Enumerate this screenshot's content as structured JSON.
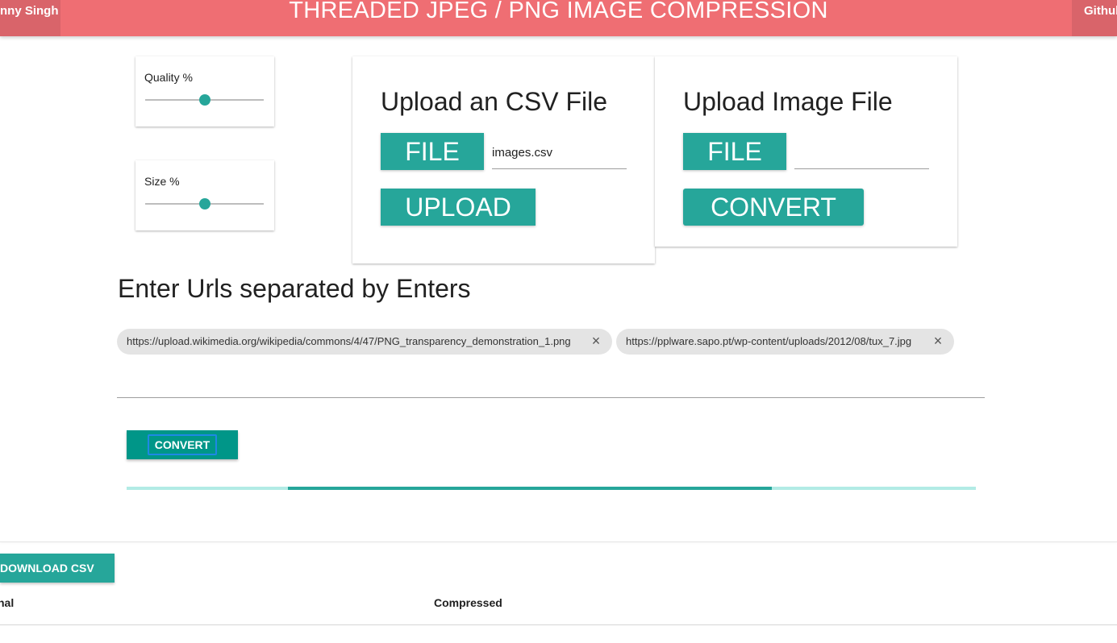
{
  "header": {
    "left_link": "nny Singh",
    "title": "THREADED JPEG / PNG IMAGE COMPRESSION",
    "right_link": "Github"
  },
  "sliders": {
    "quality": {
      "label": "Quality %",
      "value": 50
    },
    "size": {
      "label": "Size %",
      "value": 50
    }
  },
  "csv_upload": {
    "title": "Upload an CSV File",
    "file_button": "FILE",
    "file_path": "images.csv",
    "upload_button": "UPLOAD"
  },
  "image_upload": {
    "title": "Upload Image File",
    "file_button": "FILE",
    "file_path": "",
    "convert_button": "CONVERT"
  },
  "urls": {
    "heading": "Enter Urls separated by Enters",
    "chips": [
      "https://upload.wikimedia.org/wikipedia/commons/4/47/PNG_transparency_demonstration_1.png",
      "https://pplware.sapo.pt/wp-content/uploads/2012/08/tux_7.jpg"
    ]
  },
  "convert_button": "CONVERT",
  "progress": {
    "start_fraction": 0.19,
    "end_fraction": 0.76
  },
  "results": {
    "download_button": "DOWNLOAD CSV",
    "columns": [
      "nal",
      "Compressed"
    ]
  },
  "colors": {
    "header": "#ef6e73",
    "header_button": "#d9646a",
    "accent": "#26a69a",
    "progress_track": "#b2ebe5"
  },
  "icons": {
    "chip_close": "close-icon"
  }
}
